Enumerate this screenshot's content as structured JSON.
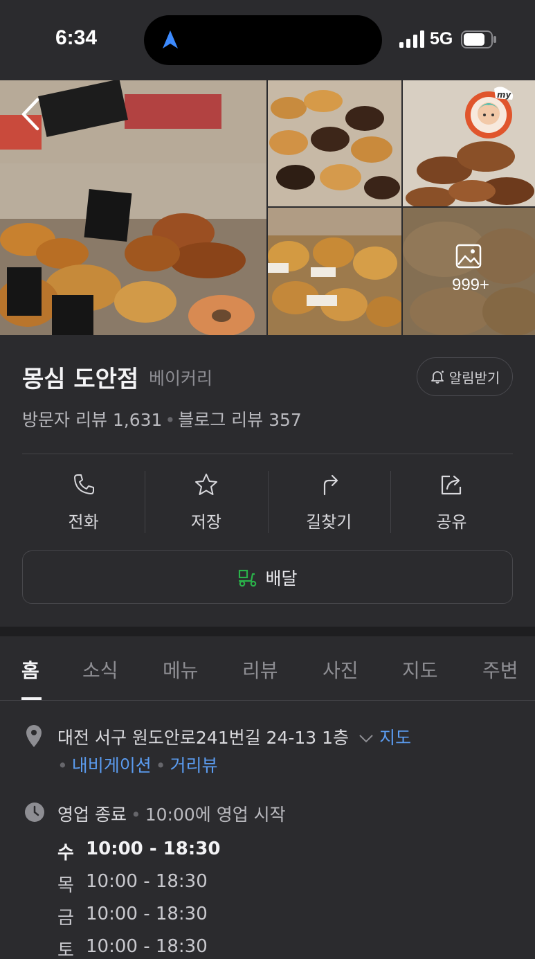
{
  "status_bar": {
    "time": "6:34",
    "network": "5G"
  },
  "photos": {
    "more_count": "999+"
  },
  "place": {
    "name": "몽심 도안점",
    "category": "베이커리",
    "notify_label": "알림받기",
    "visitor_reviews": "방문자 리뷰 1,631",
    "blog_reviews": "블로그 리뷰 357"
  },
  "actions": [
    {
      "label": "전화",
      "icon": "phone-icon"
    },
    {
      "label": "저장",
      "icon": "star-icon"
    },
    {
      "label": "길찾기",
      "icon": "directions-icon"
    },
    {
      "label": "공유",
      "icon": "share-icon"
    }
  ],
  "delivery": {
    "label": "배달",
    "color": "#2ab24a"
  },
  "tabs": [
    "홈",
    "소식",
    "메뉴",
    "리뷰",
    "사진",
    "지도",
    "주변"
  ],
  "active_tab": "홈",
  "address": {
    "text": "대전 서구 원도안로241번길 24-13 1층",
    "map_link": "지도",
    "navigation_link": "내비게이션",
    "street_view_link": "거리뷰"
  },
  "hours": {
    "status": "영업 종료",
    "opens_at": "10:00에 영업 시작",
    "days": [
      {
        "day": "수",
        "time": "10:00 - 18:30"
      },
      {
        "day": "목",
        "time": "10:00 - 18:30"
      },
      {
        "day": "금",
        "time": "10:00 - 18:30"
      },
      {
        "day": "토",
        "time": "10:00 - 18:30"
      }
    ]
  },
  "colors": {
    "link": "#5b9cf0",
    "background": "#2b2b2e",
    "accent_location": "#3d8bff"
  }
}
